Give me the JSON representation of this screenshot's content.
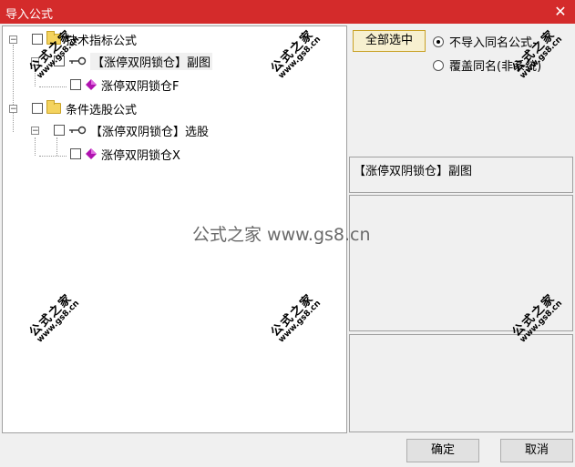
{
  "window": {
    "title": "导入公式",
    "close_glyph": "✕"
  },
  "tree": {
    "folder1": {
      "label": "技术指标公式",
      "expander": "−"
    },
    "item1": {
      "label": "【涨停双阴锁仓】副图",
      "expander": "−"
    },
    "leaf1": {
      "label": "涨停双阴锁仓F"
    },
    "folder2": {
      "label": "条件选股公式",
      "expander": "−"
    },
    "item2": {
      "label": "【涨停双阴锁仓】选股",
      "expander": "−"
    },
    "leaf2": {
      "label": "涨停双阴锁仓X"
    }
  },
  "right": {
    "select_all": "全部选中",
    "radio1": "不导入同名公式",
    "radio2": "覆盖同名(非系统)",
    "name_display": "【涨停双阴锁仓】副图"
  },
  "footer": {
    "ok": "确定",
    "cancel": "取消"
  },
  "watermark": {
    "cn": "公式之家",
    "url": "www.gs8.cn",
    "center": "公式之家 www.gs8.cn"
  }
}
